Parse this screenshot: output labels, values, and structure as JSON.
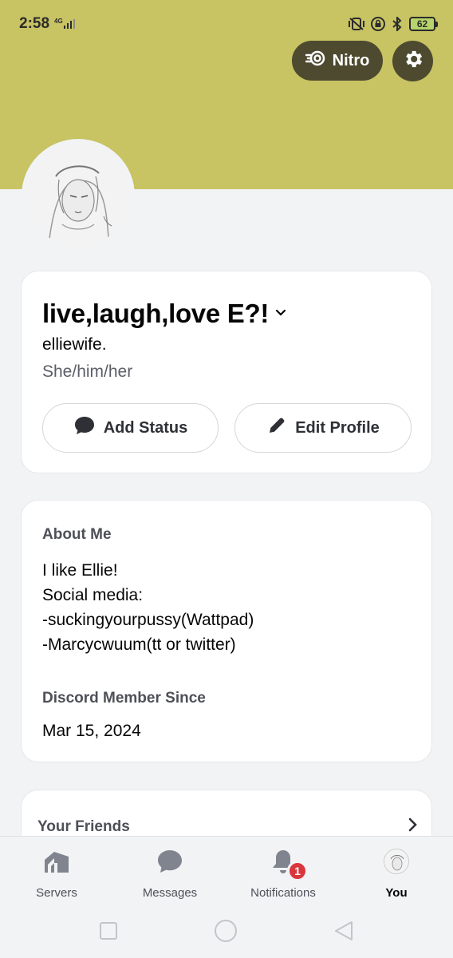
{
  "status_bar": {
    "time": "2:58",
    "network": "4G",
    "battery": "62"
  },
  "header": {
    "nitro_label": "Nitro",
    "banner_color": "#c8c363"
  },
  "profile": {
    "display_name": "live,laugh,love E?!",
    "username": "elliewife.",
    "pronouns": "She/him/her",
    "add_status_label": "Add Status",
    "edit_profile_label": "Edit Profile"
  },
  "about": {
    "title": "About Me",
    "lines": [
      "I like Ellie!",
      "Social media:",
      "-suckingyourpussy(Wattpad)",
      "-Marcycwuum(tt or twitter)"
    ],
    "member_since_title": "Discord Member Since",
    "member_since_date": "Mar 15, 2024"
  },
  "friends": {
    "title": "Your Friends"
  },
  "bottom_nav": {
    "items": [
      {
        "label": "Servers",
        "icon": "servers-icon"
      },
      {
        "label": "Messages",
        "icon": "messages-icon"
      },
      {
        "label": "Notifications",
        "icon": "bell-icon",
        "badge": "1"
      },
      {
        "label": "You",
        "icon": "avatar",
        "active": true
      }
    ]
  },
  "colors": {
    "accent_banner": "#c8c363",
    "nitro_pill": "#4d4a30",
    "badge_red": "#da373c"
  }
}
